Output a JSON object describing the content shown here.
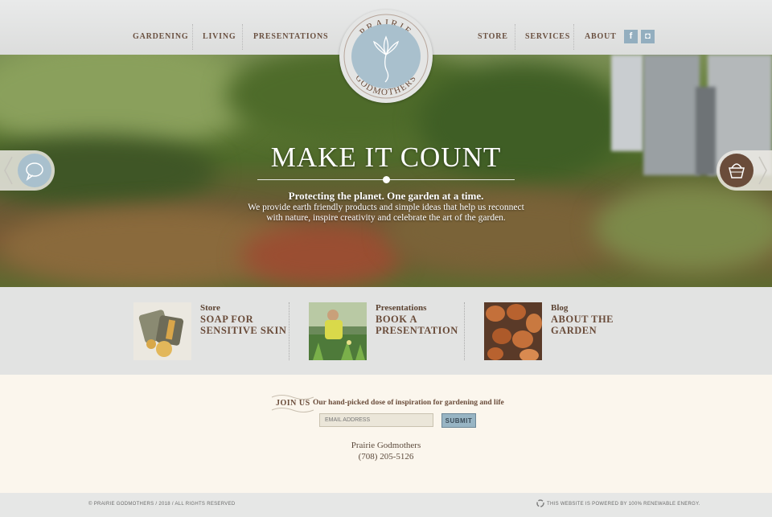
{
  "nav": {
    "left": [
      "GARDENING",
      "LIVING",
      "PRESENTATIONS"
    ],
    "right": [
      "STORE",
      "SERVICES",
      "ABOUT"
    ],
    "social": [
      {
        "icon": "facebook-icon",
        "glyph": "f"
      },
      {
        "icon": "instagram-icon",
        "glyph": "◘"
      }
    ]
  },
  "logo": {
    "top_text": "PRAIRIE",
    "bottom_text": "GODMOTHERS"
  },
  "hero": {
    "title": "MAKE IT COUNT",
    "subtitle": "Protecting the planet. One garden at a time.",
    "description": "We provide earth friendly products and simple ideas that help us reconnect with nature, inspire creativity and celebrate the art of the garden."
  },
  "features": [
    {
      "category": "Store",
      "title": "SOAP FOR SENSITIVE SKIN"
    },
    {
      "category": "Presentations",
      "title": "BOOK A PRESENTATION"
    },
    {
      "category": "Blog",
      "title": "ABOUT THE GARDEN"
    }
  ],
  "join": {
    "label": "JOIN US",
    "text": "Our hand-picked dose of inspiration for gardening and life",
    "email_placeholder": "EMAIL ADDRESS",
    "submit_label": "SUBMIT"
  },
  "contact": {
    "company": "Prairie Godmothers",
    "phone": "(708) 205-5126"
  },
  "footer": {
    "copyright": "© PRAIRIE GODMOTHERS / 2018 / ALL RIGHTS RESERVED",
    "renewable": "THIS WEBSITE IS POWERED BY 100% RENEWABLE ENERGY."
  },
  "colors": {
    "accent_blue": "#a9c0cd",
    "brand_brown": "#6a4c3a",
    "cream": "#fbf6ed"
  }
}
